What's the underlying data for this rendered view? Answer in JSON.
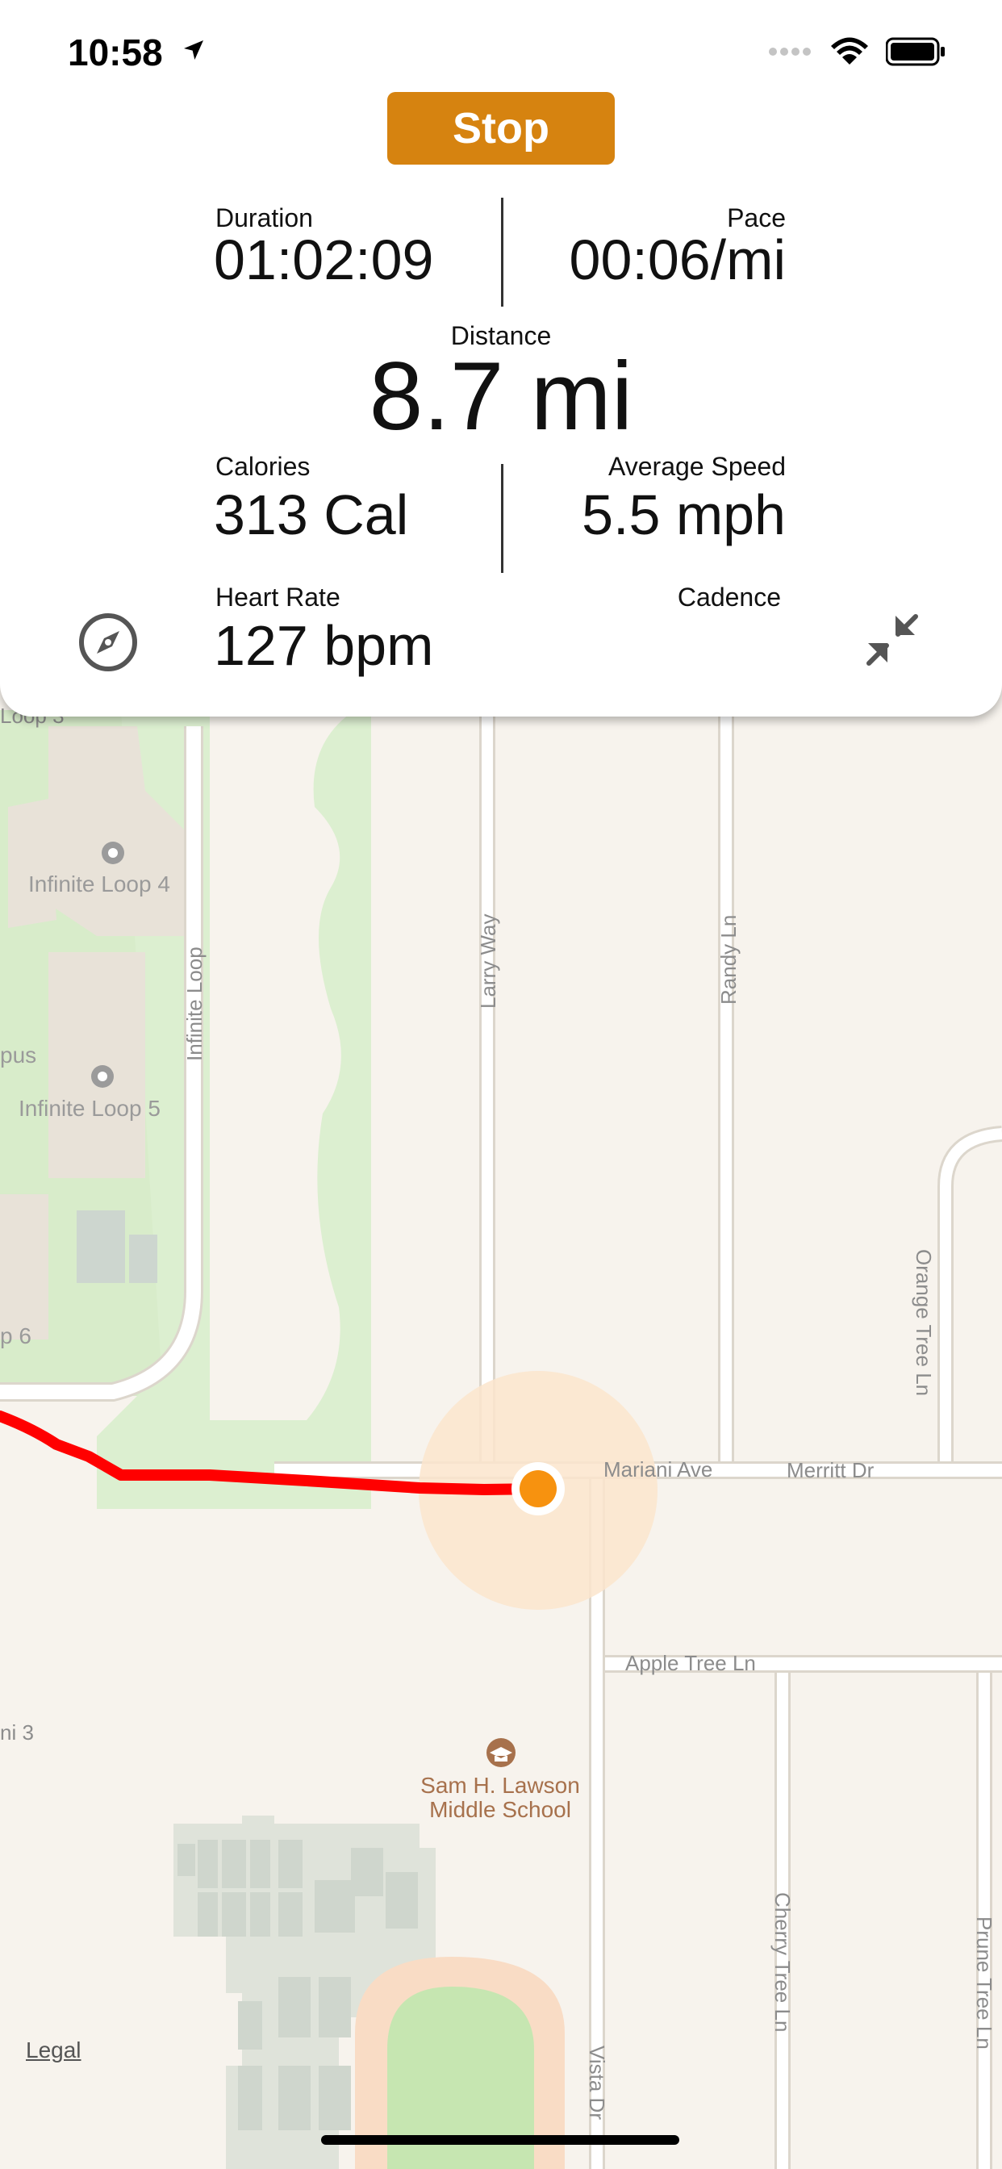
{
  "status_bar": {
    "time": "10:58"
  },
  "controls": {
    "stop_label": "Stop"
  },
  "metrics": {
    "duration": {
      "label": "Duration",
      "value": "01:02:09"
    },
    "pace": {
      "label": "Pace",
      "value": "00:06/mi"
    },
    "distance": {
      "label": "Distance",
      "value": "8.7 mi"
    },
    "calories": {
      "label": "Calories",
      "value": "313 Cal"
    },
    "average_speed": {
      "label": "Average Speed",
      "value": "5.5 mph"
    },
    "heart_rate": {
      "label": "Heart Rate",
      "value": "127 bpm"
    },
    "cadence": {
      "label": "Cadence",
      "value": ""
    }
  },
  "map": {
    "labels": {
      "loop3": "Loop 3",
      "loop4": "Infinite Loop 4",
      "campus": "pus",
      "loop5": "Infinite Loop 5",
      "loop6": "p 6",
      "infinite_loop": "Infinite Loop",
      "larry_way": "Larry Way",
      "randy_ln": "Randy Ln",
      "orange_tree_ln": "Orange Tree Ln",
      "mariani_ave": "Mariani Ave",
      "merritt_dr": "Merritt Dr",
      "apple_tree_ln": "Apple Tree Ln",
      "mariani3": "ni 3",
      "school_line1": "Sam H. Lawson",
      "school_line2": "Middle School",
      "cherry_tree_ln": "Cherry Tree Ln",
      "prune_tree_ln": "Prune Tree Ln",
      "vista_dr": "Vista Dr"
    },
    "legal": "Legal",
    "colors": {
      "route": "#ff0000",
      "location": "#f7920f",
      "park": "#d6ebc9",
      "road": "#ffffff",
      "road_edge": "#dcd6cc"
    }
  },
  "icons": {
    "compass": "compass-icon",
    "collapse": "collapse-arrows-icon"
  }
}
